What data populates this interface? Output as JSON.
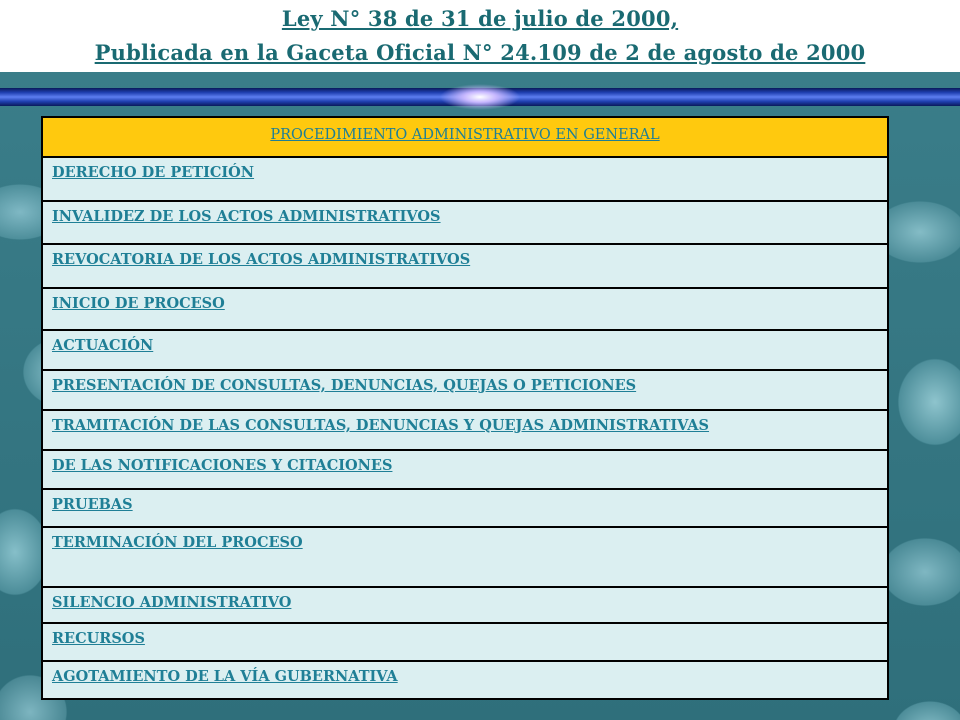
{
  "header": {
    "title_line1": "Ley N° 38 de 31 de julio de  2000,",
    "title_line2": "Publicada en la Gaceta Oficial N° 24.109 de 2 de agosto de 2000"
  },
  "colors": {
    "header_row_bg": "#ffc90e",
    "row_bg": "#dbeff1",
    "link": "#1f7f96",
    "title": "#1a6a72"
  },
  "table": {
    "heading": "PROCEDIMIENTO ADMINISTRATIVO EN GENERAL",
    "items": [
      "DERECHO DE PETICIÓN",
      "INVALIDEZ DE LOS ACTOS ADMINISTRATIVOS",
      "REVOCATORIA DE LOS ACTOS ADMINISTRATIVOS",
      "INICIO DE PROCESO",
      "ACTUACIÓN",
      "PRESENTACIÓN DE CONSULTAS, DENUNCIAS, QUEJAS O PETICIONES",
      "TRAMITACIÓN DE LAS CONSULTAS, DENUNCIAS Y QUEJAS ADMINISTRATIVAS",
      "DE LAS NOTIFICACIONES Y CITACIONES",
      "PRUEBAS",
      "TERMINACIÓN DEL PROCESO",
      "SILENCIO ADMINISTRATIVO",
      "RECURSOS",
      "AGOTAMIENTO DE LA VÍA GUBERNATIVA"
    ]
  }
}
